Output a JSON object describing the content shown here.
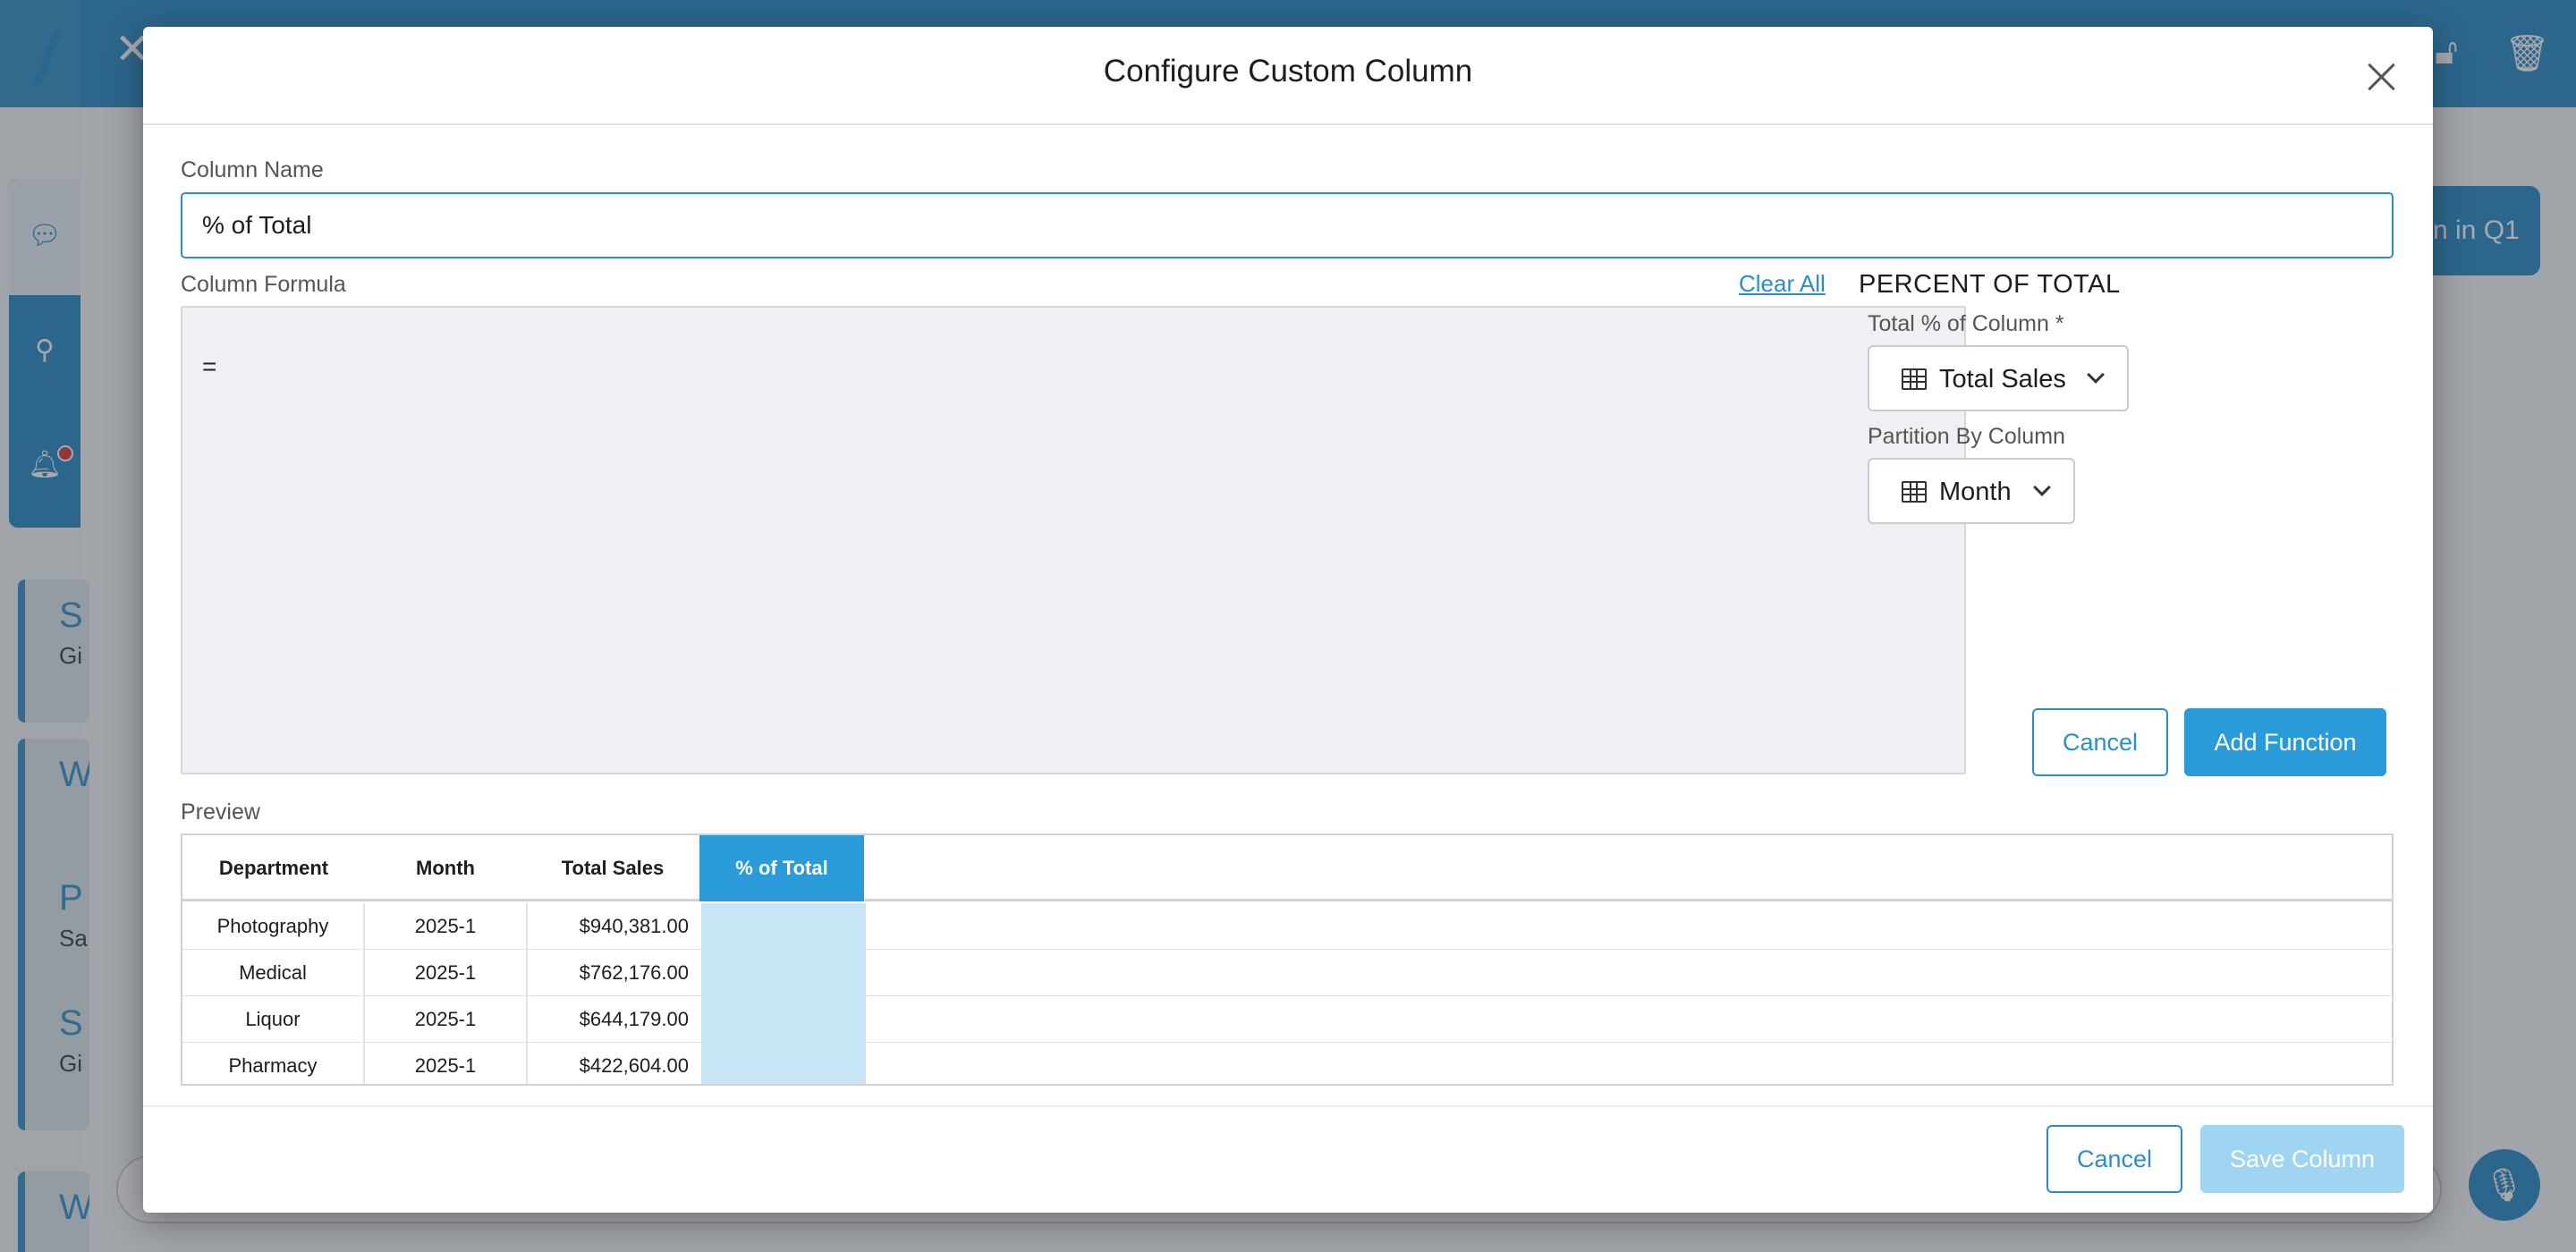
{
  "modal": {
    "title": "Configure Custom Column",
    "column_name_label": "Column Name",
    "column_name_value": "% of Total",
    "column_formula_label": "Column Formula",
    "clear_all": "Clear All",
    "formula_text": "=",
    "function_panel": {
      "title": "PERCENT OF TOTAL",
      "total_label": "Total % of Column *",
      "total_value": "Total Sales",
      "partition_label": "Partition By Column",
      "partition_value": "Month",
      "cancel": "Cancel",
      "add": "Add Function"
    },
    "preview_label": "Preview",
    "preview": {
      "columns": [
        "Department",
        "Month",
        "Total Sales",
        "% of Total"
      ],
      "rows": [
        [
          "Photography",
          "2025-1",
          "$940,381.00",
          ""
        ],
        [
          "Medical",
          "2025-1",
          "$762,176.00",
          ""
        ],
        [
          "Liquor",
          "2025-1",
          "$644,179.00",
          ""
        ],
        [
          "Pharmacy",
          "2025-1",
          "$422,604.00",
          ""
        ]
      ]
    },
    "footer": {
      "cancel": "Cancel",
      "save": "Save Column"
    }
  },
  "background": {
    "pill_text": "n in Q1",
    "cards": [
      {
        "title": "S",
        "sub": "Gi"
      },
      {
        "title": "W",
        "sub": ""
      },
      {
        "title": "P",
        "sub": "Sa"
      },
      {
        "title": "S",
        "sub": "Gi"
      },
      {
        "title": "W",
        "sub": ""
      }
    ]
  },
  "colors": {
    "accent": "#2a9ad8",
    "header": "#1f86c5",
    "preview_highlight": "#c9e6f6",
    "disabled_button": "#9fd5f0"
  }
}
